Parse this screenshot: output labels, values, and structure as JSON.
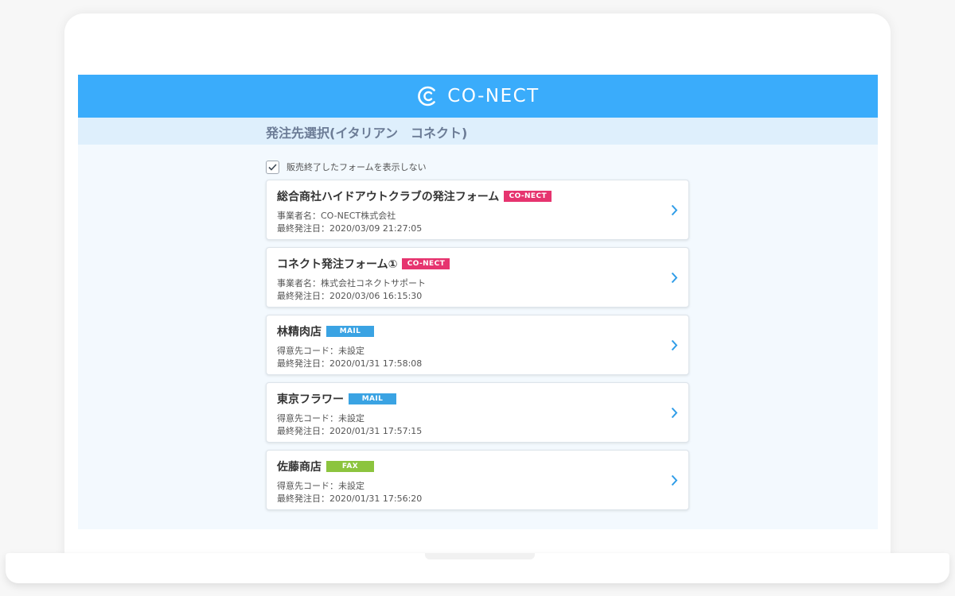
{
  "brand": {
    "name": "CO-NECT",
    "header_color": "#3aacfb"
  },
  "page": {
    "title": "発注先選択(イタリアン　コネクト)"
  },
  "filter": {
    "label": "販売終了したフォームを表示しない",
    "checked": true
  },
  "badge_colors": {
    "CO-NECT": "#e6346f",
    "MAIL": "#3aa3e3",
    "FAX": "#8cc43e"
  },
  "forms": [
    {
      "name": "総合商社ハイドアウトクラブの発注フォーム",
      "badge": "CO-NECT",
      "line1": "事業者名：CO-NECT株式会社",
      "line2": "最終発注日：2020/03/09 21:27:05"
    },
    {
      "name": "コネクト発注フォーム①",
      "badge": "CO-NECT",
      "line1": "事業者名：株式会社コネクトサポート",
      "line2": "最終発注日：2020/03/06 16:15:30"
    },
    {
      "name": "林精肉店",
      "badge": "MAIL",
      "line1": "得意先コード：未設定",
      "line2": "最終発注日：2020/01/31 17:58:08"
    },
    {
      "name": "東京フラワー",
      "badge": "MAIL",
      "line1": "得意先コード：未設定",
      "line2": "最終発注日：2020/01/31 17:57:15"
    },
    {
      "name": "佐藤商店",
      "badge": "FAX",
      "line1": "得意先コード：未設定",
      "line2": "最終発注日：2020/01/31 17:56:20"
    }
  ],
  "icons": {
    "logo": "conect-logo-icon",
    "check": "checkmark-icon",
    "chevron": "chevron-right-icon"
  }
}
